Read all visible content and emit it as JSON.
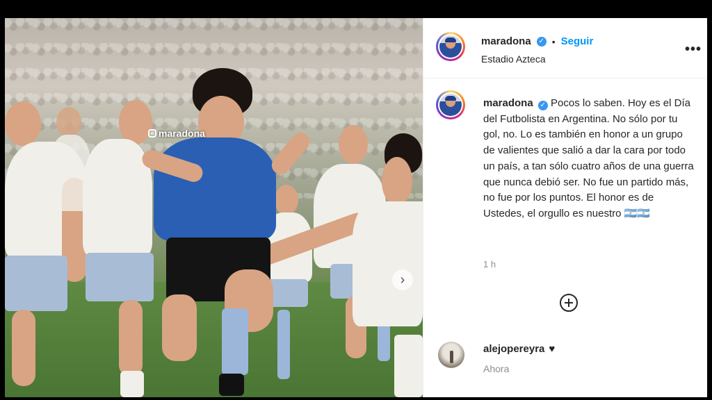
{
  "watermark": {
    "handle": "maradona"
  },
  "header": {
    "username": "maradona",
    "verified_glyph": "✓",
    "separator": "•",
    "follow_label": "Seguir",
    "location": "Estadio Azteca",
    "more_glyph": "•••"
  },
  "caption": {
    "username": "maradona",
    "verified_glyph": "✓",
    "text": "Pocos lo saben. Hoy es el Día del Futbolista en Argentina. No sólo por tu gol, no. Lo es también en honor a un grupo de valientes que salió a dar la cara por todo un país, a tan sólo cuatro años de una guerra que nunca debió ser. No fue un partido más, no fue por los puntos. El honor es de Ustedes, el orgullo es nuestro 🇦🇷🇦🇷",
    "time": "1 h"
  },
  "media": {
    "next_glyph": "›"
  },
  "comment": {
    "username": "alejopereyra",
    "heart_glyph": "♥",
    "time": "Ahora"
  },
  "icons": [
    "instagram-icon",
    "verified-badge-icon",
    "more-options-icon",
    "chevron-right-icon",
    "add-comment-plus-icon",
    "heart-icon"
  ],
  "colors": {
    "follow": "#0095f6",
    "verified": "#3897f0",
    "muted": "#8e8e8e",
    "text": "#262626"
  }
}
